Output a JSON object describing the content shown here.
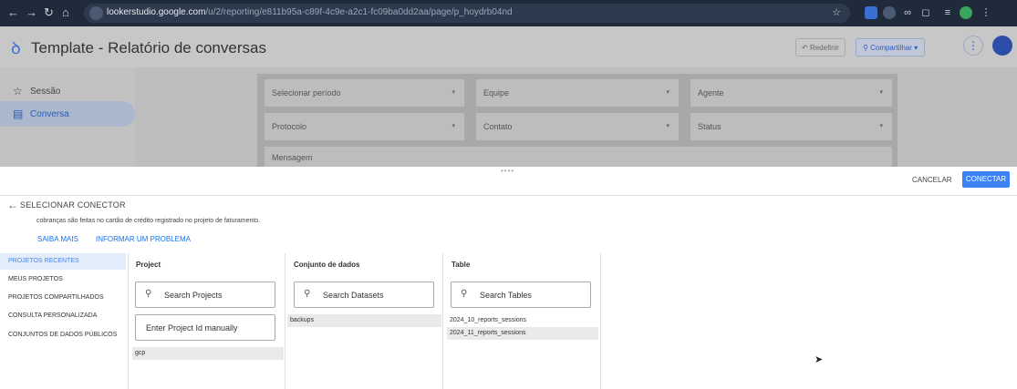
{
  "browser": {
    "url_host": "lookerstudio.google.com",
    "url_path": "/u/2/reporting/e811b95a-c89f-4c9e-a2c1-fc09ba0dd2aa/page/p_hoydrb04nd",
    "back_icon": "arrow-left-icon",
    "forward_icon": "arrow-right-icon",
    "reload_icon": "reload-icon",
    "home_icon": "home-icon"
  },
  "header": {
    "title": "Template - Relatório de conversas",
    "redo_label": "Redefinir",
    "share_label": "Compartilhar",
    "accent": "#2d5cc0"
  },
  "pages": {
    "items": [
      {
        "label": "Sessão",
        "icon": "star-icon"
      },
      {
        "label": "Conversa",
        "icon": "page-icon"
      }
    ]
  },
  "controls": {
    "row1": [
      "Selecionar período",
      "Equipe",
      "Agente"
    ],
    "row2": [
      "Protocolo",
      "Contato",
      "Status"
    ],
    "row3": [
      "Mensagem"
    ]
  },
  "panel": {
    "handle": "••••",
    "cancel_label": "CANCELAR",
    "connect_label": "CONECTAR",
    "title": "SELECIONAR CONECTOR",
    "billing_text": "cobranças são feitas no cartão de crédito registrado no projeto de faturamento.",
    "learn_more": "SAIBA MAIS",
    "report_problem": "INFORMAR UM PROBLEMA",
    "connect_color": "#3b82f6"
  },
  "nav": {
    "items": [
      "PROJETOS RECENTES",
      "MEUS PROJETOS",
      "PROJETOS COMPARTILHADOS",
      "CONSULTA PERSONALIZADA",
      "CONJUNTOS DE DADOS PÚBLICOS"
    ]
  },
  "columns": {
    "project": {
      "header": "Project",
      "search_placeholder": "Search Projects",
      "manual_placeholder": "Enter Project Id manually",
      "rows": [
        "gcp"
      ]
    },
    "dataset": {
      "header": "Conjunto de dados",
      "search_placeholder": "Search Datasets",
      "rows": [
        "backups"
      ]
    },
    "table": {
      "header": "Table",
      "search_placeholder": "Search Tables",
      "rows": [
        "2024_10_reports_sessions",
        "2024_11_reports_sessions"
      ]
    }
  }
}
